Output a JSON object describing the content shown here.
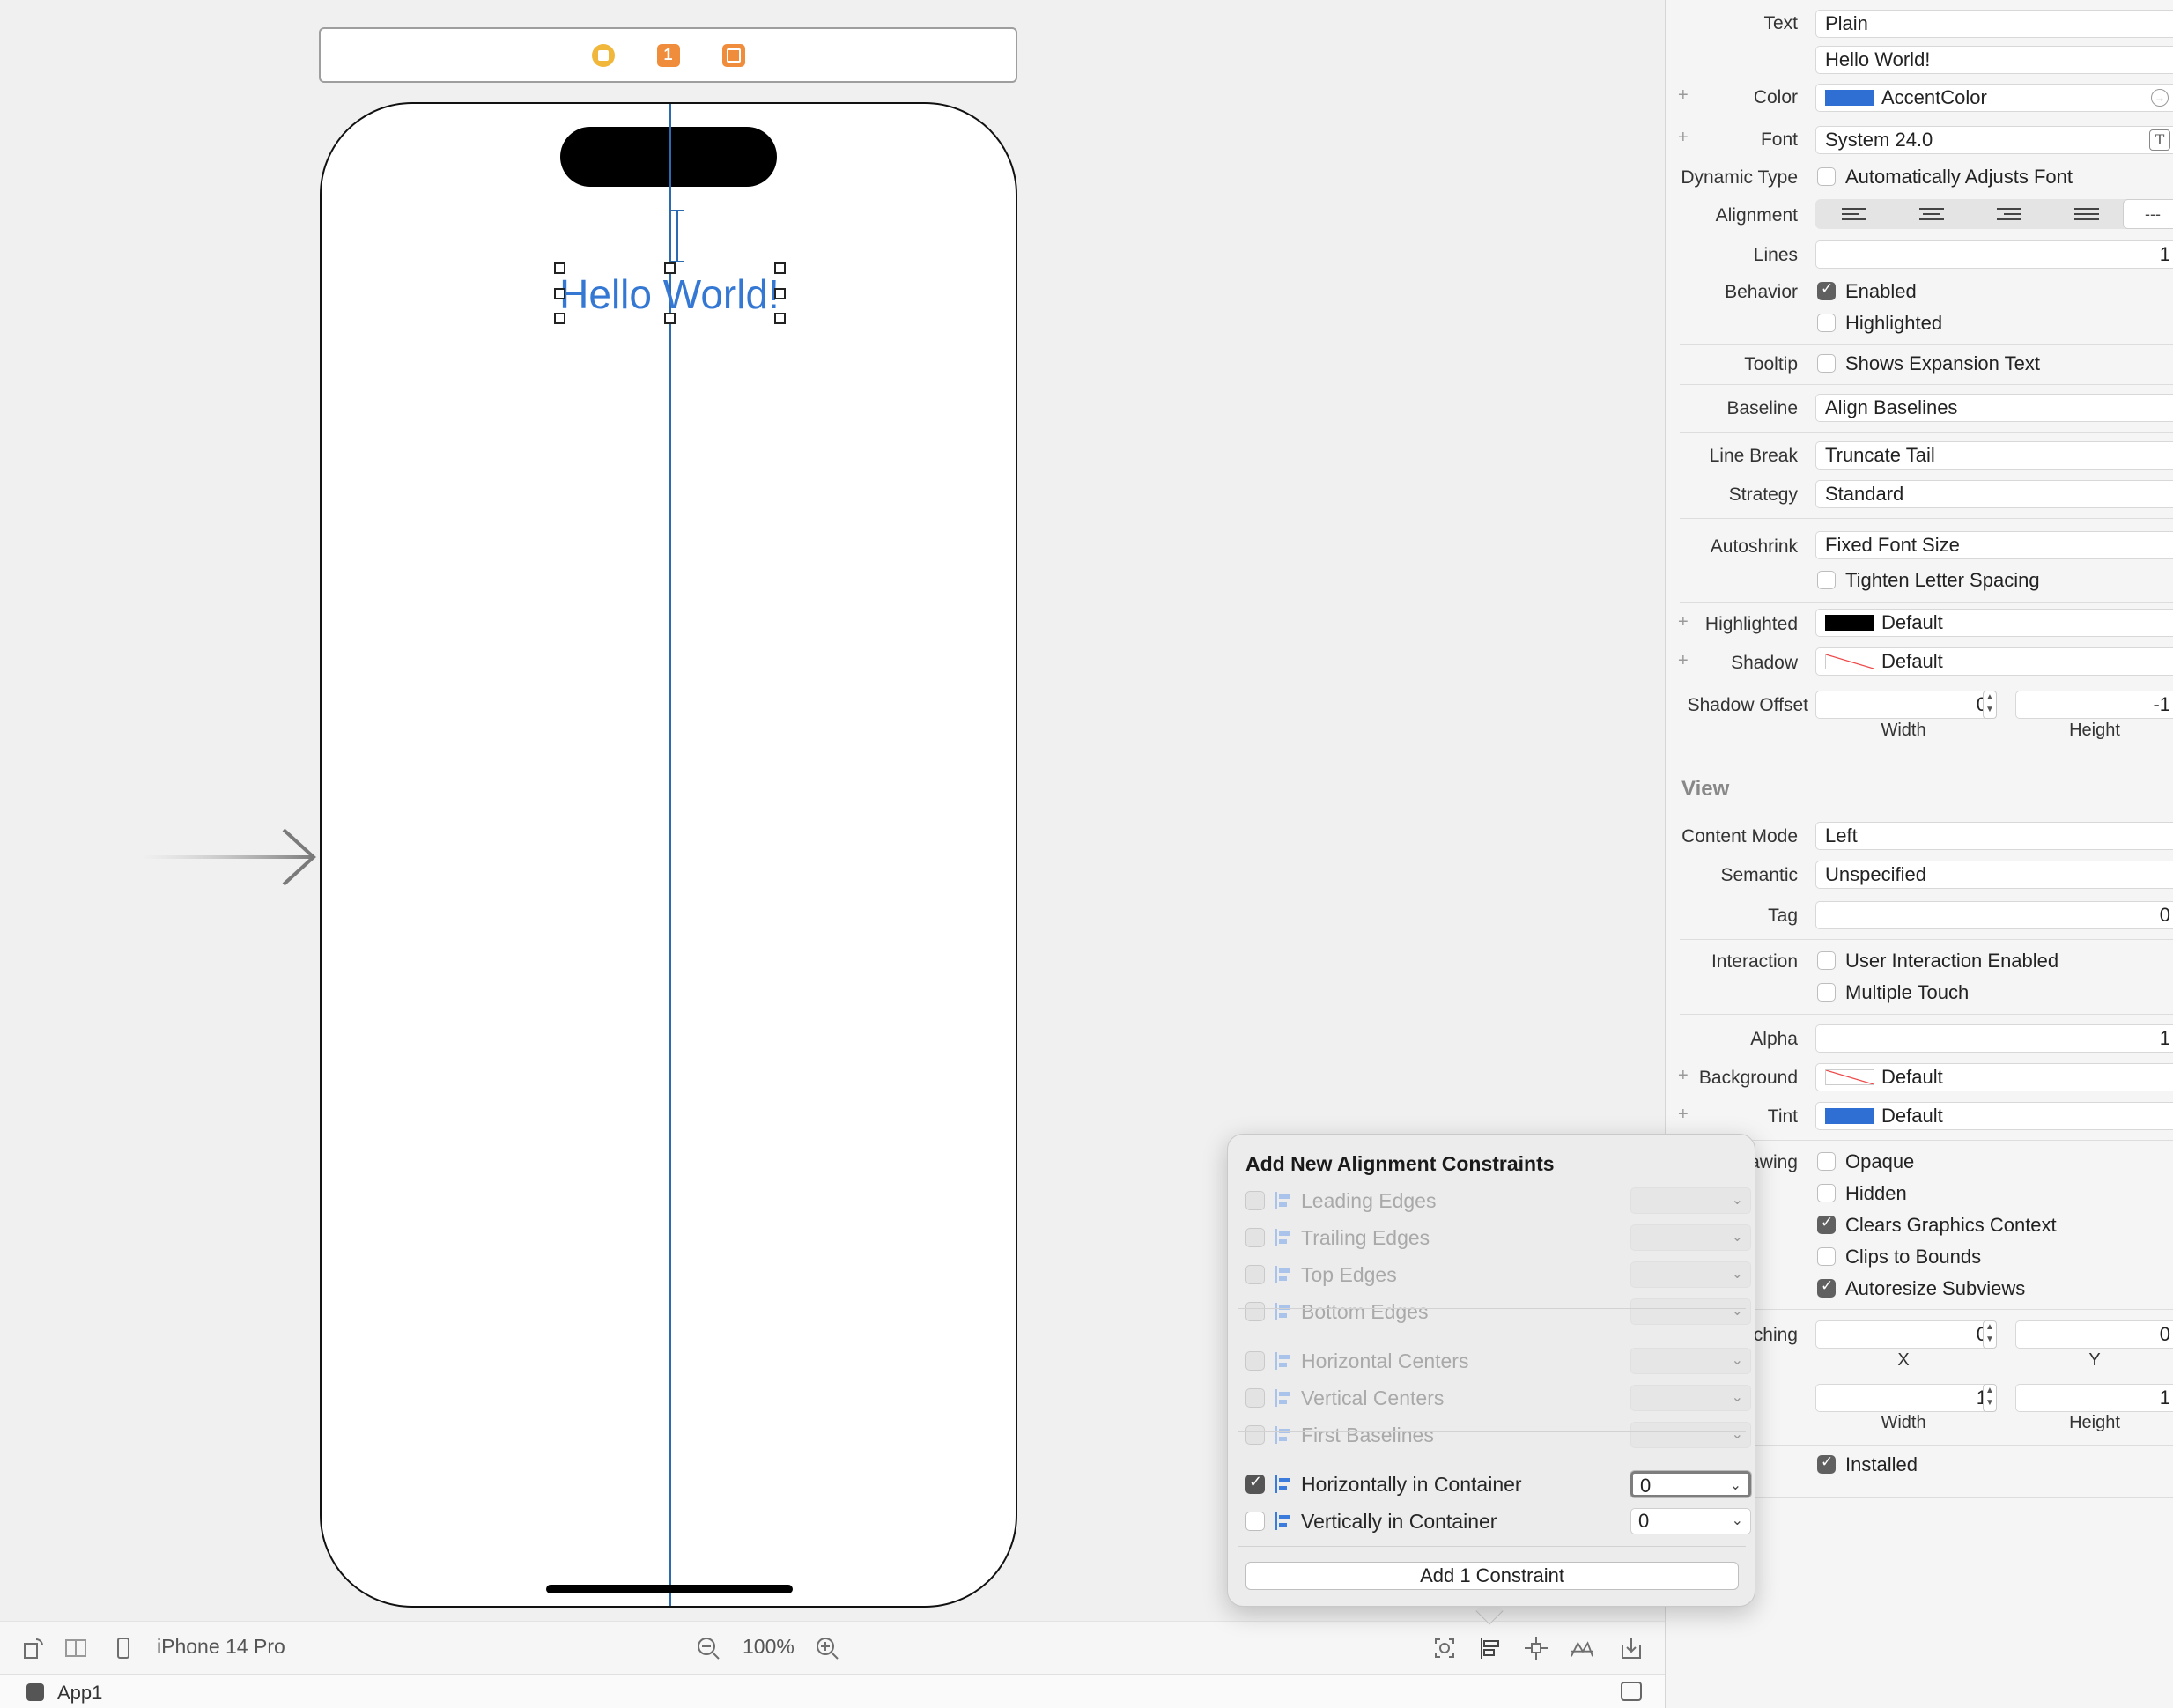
{
  "canvas": {
    "label_text": "Hello World!",
    "first_responder_badge": "1"
  },
  "bottom_bar": {
    "device": "iPhone 14 Pro",
    "zoom": "100%",
    "app_name": "App1"
  },
  "popover": {
    "title": "Add New Alignment Constraints",
    "rows": [
      {
        "label": "Leading Edges",
        "checked": false,
        "enabled": false,
        "value": ""
      },
      {
        "label": "Trailing Edges",
        "checked": false,
        "enabled": false,
        "value": ""
      },
      {
        "label": "Top Edges",
        "checked": false,
        "enabled": false,
        "value": ""
      },
      {
        "label": "Bottom Edges",
        "checked": false,
        "enabled": false,
        "value": ""
      },
      {
        "label": "Horizontal Centers",
        "checked": false,
        "enabled": false,
        "value": ""
      },
      {
        "label": "Vertical Centers",
        "checked": false,
        "enabled": false,
        "value": ""
      },
      {
        "label": "First Baselines",
        "checked": false,
        "enabled": false,
        "value": ""
      },
      {
        "label": "Horizontally in Container",
        "checked": true,
        "enabled": true,
        "value": "0"
      },
      {
        "label": "Vertically in Container",
        "checked": false,
        "enabled": true,
        "value": "0"
      }
    ],
    "add_button": "Add 1 Constraint"
  },
  "inspector": {
    "text_label": "Text",
    "text_type": "Plain",
    "text_value": "Hello World!",
    "color_label": "Color",
    "color_value": "AccentColor",
    "font_label": "Font",
    "font_value": "System 24.0",
    "dynamic_type_label": "Dynamic Type",
    "dynamic_type_cb": "Automatically Adjusts Font",
    "alignment_label": "Alignment",
    "alignment_natural": "---",
    "lines_label": "Lines",
    "lines_value": "1",
    "behavior_label": "Behavior",
    "behavior_enabled": "Enabled",
    "behavior_highlighted": "Highlighted",
    "tooltip_label": "Tooltip",
    "tooltip_cb": "Shows Expansion Text",
    "baseline_label": "Baseline",
    "baseline_value": "Align Baselines",
    "line_break_label": "Line Break",
    "line_break_value": "Truncate Tail",
    "strategy_label": "Strategy",
    "strategy_value": "Standard",
    "autoshrink_label": "Autoshrink",
    "autoshrink_value": "Fixed Font Size",
    "autoshrink_cb": "Tighten Letter Spacing",
    "highlighted_label": "Highlighted",
    "highlighted_value": "Default",
    "shadow_label": "Shadow",
    "shadow_value": "Default",
    "shadow_offset_label": "Shadow Offset",
    "shadow_offset_width": "0",
    "shadow_offset_height": "-1",
    "width_sublabel": "Width",
    "height_sublabel": "Height",
    "view_section": "View",
    "content_mode_label": "Content Mode",
    "content_mode_value": "Left",
    "semantic_label": "Semantic",
    "semantic_value": "Unspecified",
    "tag_label": "Tag",
    "tag_value": "0",
    "interaction_label": "Interaction",
    "interaction_cb1": "User Interaction Enabled",
    "interaction_cb2": "Multiple Touch",
    "alpha_label": "Alpha",
    "alpha_value": "1",
    "background_label": "Background",
    "background_value": "Default",
    "tint_label": "Tint",
    "tint_value": "Default",
    "drawing_label_partial": "rawing",
    "drawing_opaque": "Opaque",
    "drawing_hidden": "Hidden",
    "drawing_clears": "Clears Graphics Context",
    "drawing_clips": "Clips to Bounds",
    "drawing_autoresize": "Autoresize Subviews",
    "stretching_label_partial": "tching",
    "stretching_x": "0",
    "stretching_y": "0",
    "x_sublabel": "X",
    "y_sublabel": "Y",
    "stretching_w": "1",
    "stretching_h": "1",
    "installed_cb": "Installed"
  },
  "colors": {
    "accent": "#2f6fd4",
    "guide": "#2c6bb0",
    "label_text": "#3478d4"
  }
}
